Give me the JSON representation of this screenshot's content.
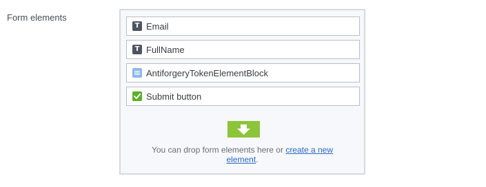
{
  "form_elements": {
    "label": "Form elements",
    "items": [
      {
        "label": "Email",
        "icon": "text-icon",
        "icon_glyph": "T"
      },
      {
        "label": "FullName",
        "icon": "text-icon",
        "icon_glyph": "T"
      },
      {
        "label": "AntiforgeryTokenElementBlock",
        "icon": "document-icon"
      },
      {
        "label": "Submit button",
        "icon": "checkmark-icon"
      }
    ],
    "drop_zone": {
      "text_before": "You can drop form elements here or ",
      "link_line1": "create a new",
      "link_line2": "element",
      "text_after": ".",
      "arrow_icon": "down-arrow-icon",
      "arrow_color": "#8cc43a"
    }
  }
}
